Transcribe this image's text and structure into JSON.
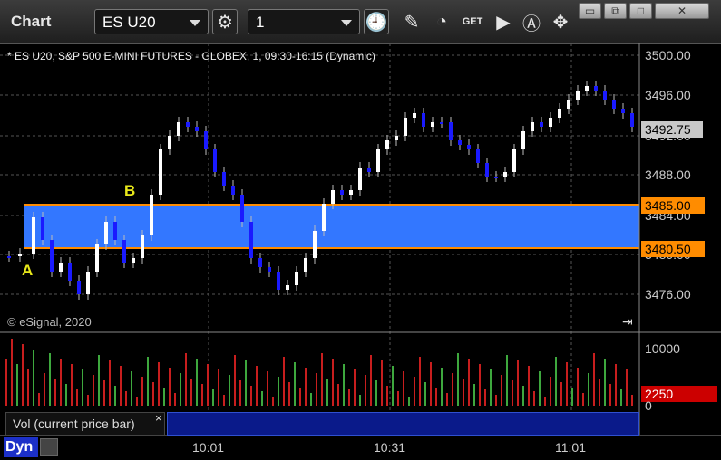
{
  "toolbar": {
    "title": "Chart",
    "symbol": "ES U20",
    "interval": "1",
    "icons": [
      "settings-icon",
      "clock-icon",
      "pencil-icon",
      "study-icon",
      "get-icon",
      "play-icon",
      "alert-icon",
      "move-icon"
    ],
    "window_buttons": [
      "restore-icon",
      "external-icon",
      "maximize-icon",
      "close-icon"
    ]
  },
  "chart": {
    "label": "* ES U20, S&P 500 E-MINI FUTURES - GLOBEX, 1, 09:30-16:15 (Dynamic)",
    "copyright": "© eSignal, 2020",
    "price_axis": [
      "3500.00",
      "3496.00",
      "3492.00",
      "3488.00",
      "3484.00",
      "3480.00",
      "3476.00"
    ],
    "current_price": "3492.75",
    "zone_high": "3485.00",
    "zone_low": "3480.50",
    "marker_a": "A",
    "marker_b": "B"
  },
  "volume": {
    "label": "Vol (current price bar)",
    "axis_top": "10000",
    "axis_zero": "0",
    "current": "2250"
  },
  "time_axis": [
    "10:01",
    "10:31",
    "11:01"
  ],
  "dyn_label": "Dyn",
  "colors": {
    "up": "#ffffff",
    "down": "#1a1aff",
    "zone": "#3377ff",
    "zone_edge": "#ff8c00",
    "marker": "#e8e81a",
    "vol_up": "#3ea83e",
    "vol_down": "#c81e1e"
  }
}
